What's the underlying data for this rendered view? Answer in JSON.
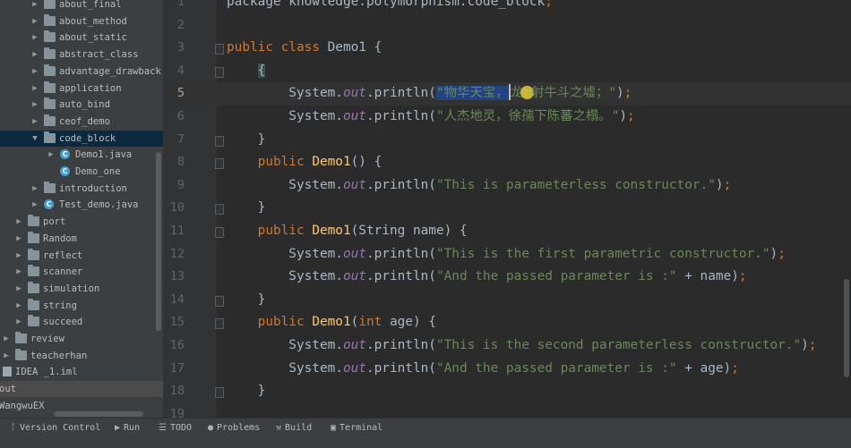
{
  "project_tree": [
    {
      "label": "about_final",
      "depth": 3,
      "kind": "folder",
      "state": "collapsed"
    },
    {
      "label": "about_method",
      "depth": 3,
      "kind": "folder",
      "state": "collapsed"
    },
    {
      "label": "about_static",
      "depth": 3,
      "kind": "folder",
      "state": "collapsed"
    },
    {
      "label": "abstract_class",
      "depth": 3,
      "kind": "folder",
      "state": "collapsed"
    },
    {
      "label": "advantage_drawback",
      "depth": 3,
      "kind": "folder",
      "state": "collapsed"
    },
    {
      "label": "application",
      "depth": 3,
      "kind": "folder",
      "state": "collapsed"
    },
    {
      "label": "auto_bind",
      "depth": 3,
      "kind": "folder",
      "state": "collapsed"
    },
    {
      "label": "ceof_demo",
      "depth": 3,
      "kind": "folder",
      "state": "collapsed"
    },
    {
      "label": "code_block",
      "depth": 3,
      "kind": "folder",
      "state": "expanded",
      "selected": true
    },
    {
      "label": "Demo1.java",
      "depth": 4,
      "kind": "java-class",
      "state": "collapsed"
    },
    {
      "label": "Demo_one",
      "depth": 4,
      "kind": "java-class",
      "state": "none"
    },
    {
      "label": "introduction",
      "depth": 3,
      "kind": "folder",
      "state": "collapsed"
    },
    {
      "label": "Test_demo.java",
      "depth": 3,
      "kind": "java-class",
      "state": "collapsed"
    },
    {
      "label": "port",
      "depth": 2,
      "kind": "folder",
      "state": "collapsed"
    },
    {
      "label": "Random",
      "depth": 2,
      "kind": "folder",
      "state": "collapsed"
    },
    {
      "label": "reflect",
      "depth": 2,
      "kind": "folder",
      "state": "collapsed"
    },
    {
      "label": "scanner",
      "depth": 2,
      "kind": "folder",
      "state": "collapsed"
    },
    {
      "label": "simulation",
      "depth": 2,
      "kind": "folder",
      "state": "collapsed"
    },
    {
      "label": "string",
      "depth": 2,
      "kind": "folder",
      "state": "collapsed"
    },
    {
      "label": "succeed",
      "depth": 2,
      "kind": "folder",
      "state": "collapsed"
    },
    {
      "label": "review",
      "depth": 1,
      "kind": "folder",
      "state": "collapsed"
    },
    {
      "label": "teacherhan",
      "depth": 1,
      "kind": "folder",
      "state": "collapsed"
    },
    {
      "label": "IDEA _1.iml",
      "depth": 0,
      "kind": "file",
      "state": "none"
    },
    {
      "label": "out",
      "depth": 0,
      "kind": "plain",
      "state": "none",
      "highlight": true
    },
    {
      "label": "WangwuEX",
      "depth": 0,
      "kind": "plain",
      "state": "none"
    }
  ],
  "editor": {
    "current_line": 5,
    "lines": [
      {
        "num": "1",
        "fold": false,
        "tokens": [
          {
            "t": "package knowledge.polymorphism.code_block",
            "c": "plain"
          },
          {
            "t": ";",
            "c": "semi"
          }
        ]
      },
      {
        "num": "2",
        "fold": false,
        "tokens": []
      },
      {
        "num": "3",
        "fold": true,
        "tokens": [
          {
            "t": "public class ",
            "c": "keyword"
          },
          {
            "t": "Demo1 {",
            "c": "plain"
          }
        ]
      },
      {
        "num": "4",
        "fold": true,
        "tokens": [
          {
            "t": "    ",
            "c": "plain"
          },
          {
            "t": "{",
            "c": "brace-hl"
          }
        ]
      },
      {
        "num": "5",
        "fold": false,
        "tokens": [
          {
            "t": "        System.",
            "c": "plain"
          },
          {
            "t": "out",
            "c": "field"
          },
          {
            "t": ".println(",
            "c": "plain"
          },
          {
            "t": "\"物华天宝，",
            "c": "sel"
          },
          {
            "t": "",
            "c": "caret"
          },
          {
            "t": "龙",
            "c": "string"
          },
          {
            "t": "",
            "c": "cursor"
          },
          {
            "t": "射牛斗之墟；\"",
            "c": "string"
          },
          {
            "t": ")",
            "c": "plain"
          },
          {
            "t": ";",
            "c": "semi"
          }
        ]
      },
      {
        "num": "6",
        "fold": false,
        "tokens": [
          {
            "t": "        System.",
            "c": "plain"
          },
          {
            "t": "out",
            "c": "field"
          },
          {
            "t": ".println(",
            "c": "plain"
          },
          {
            "t": "\"人杰地灵，徐孺下陈蕃之榻。\"",
            "c": "string"
          },
          {
            "t": ")",
            "c": "plain"
          },
          {
            "t": ";",
            "c": "semi"
          }
        ]
      },
      {
        "num": "7",
        "fold": true,
        "tokens": [
          {
            "t": "    }",
            "c": "plain"
          }
        ]
      },
      {
        "num": "8",
        "fold": true,
        "tokens": [
          {
            "t": "    public ",
            "c": "keyword"
          },
          {
            "t": "Demo1",
            "c": "method"
          },
          {
            "t": "() {",
            "c": "plain"
          }
        ]
      },
      {
        "num": "9",
        "fold": false,
        "tokens": [
          {
            "t": "        System.",
            "c": "plain"
          },
          {
            "t": "out",
            "c": "field"
          },
          {
            "t": ".println(",
            "c": "plain"
          },
          {
            "t": "\"This is parameterless constructor.\"",
            "c": "string"
          },
          {
            "t": ")",
            "c": "plain"
          },
          {
            "t": ";",
            "c": "semi"
          }
        ]
      },
      {
        "num": "10",
        "fold": true,
        "tokens": [
          {
            "t": "    }",
            "c": "plain"
          }
        ]
      },
      {
        "num": "11",
        "fold": true,
        "tokens": [
          {
            "t": "    public ",
            "c": "keyword"
          },
          {
            "t": "Demo1",
            "c": "method"
          },
          {
            "t": "(String name) {",
            "c": "plain"
          }
        ]
      },
      {
        "num": "12",
        "fold": false,
        "tokens": [
          {
            "t": "        System.",
            "c": "plain"
          },
          {
            "t": "out",
            "c": "field"
          },
          {
            "t": ".println(",
            "c": "plain"
          },
          {
            "t": "\"This is the first parametric constructor.\"",
            "c": "string"
          },
          {
            "t": ")",
            "c": "plain"
          },
          {
            "t": ";",
            "c": "semi"
          }
        ]
      },
      {
        "num": "13",
        "fold": false,
        "tokens": [
          {
            "t": "        System.",
            "c": "plain"
          },
          {
            "t": "out",
            "c": "field"
          },
          {
            "t": ".println(",
            "c": "plain"
          },
          {
            "t": "\"And the passed parameter is :\"",
            "c": "string"
          },
          {
            "t": " + name)",
            "c": "plain"
          },
          {
            "t": ";",
            "c": "semi"
          }
        ]
      },
      {
        "num": "14",
        "fold": true,
        "tokens": [
          {
            "t": "    }",
            "c": "plain"
          }
        ]
      },
      {
        "num": "15",
        "fold": true,
        "tokens": [
          {
            "t": "    public ",
            "c": "keyword"
          },
          {
            "t": "Demo1",
            "c": "method"
          },
          {
            "t": "(",
            "c": "plain"
          },
          {
            "t": "int ",
            "c": "keyword"
          },
          {
            "t": "age) {",
            "c": "plain"
          }
        ]
      },
      {
        "num": "16",
        "fold": false,
        "tokens": [
          {
            "t": "        System.",
            "c": "plain"
          },
          {
            "t": "out",
            "c": "field"
          },
          {
            "t": ".println(",
            "c": "plain"
          },
          {
            "t": "\"This is the second parameterless constructor.\"",
            "c": "string"
          },
          {
            "t": ")",
            "c": "plain"
          },
          {
            "t": ";",
            "c": "semi"
          }
        ]
      },
      {
        "num": "17",
        "fold": false,
        "tokens": [
          {
            "t": "        System.",
            "c": "plain"
          },
          {
            "t": "out",
            "c": "field"
          },
          {
            "t": ".println(",
            "c": "plain"
          },
          {
            "t": "\"And the passed parameter is :\"",
            "c": "string"
          },
          {
            "t": " + age)",
            "c": "plain"
          },
          {
            "t": ";",
            "c": "semi"
          }
        ]
      },
      {
        "num": "18",
        "fold": true,
        "tokens": [
          {
            "t": "    }",
            "c": "plain"
          }
        ]
      },
      {
        "num": "19",
        "fold": false,
        "tokens": []
      }
    ]
  },
  "bottom_tabs": [
    {
      "label": "Version Control",
      "icon": "branch-icon"
    },
    {
      "label": "Run",
      "icon": "play-icon"
    },
    {
      "label": "TODO",
      "icon": "list-icon"
    },
    {
      "label": "Problems",
      "icon": "info-icon"
    },
    {
      "label": "Build",
      "icon": "hammer-icon"
    },
    {
      "label": "Terminal",
      "icon": "terminal-icon"
    }
  ],
  "colors": {
    "editor_bg": "#2b2b2b",
    "keyword": "#cc7832",
    "string": "#6a8759",
    "method": "#ffc66d",
    "field": "#9876aa",
    "selection": "#214283"
  }
}
